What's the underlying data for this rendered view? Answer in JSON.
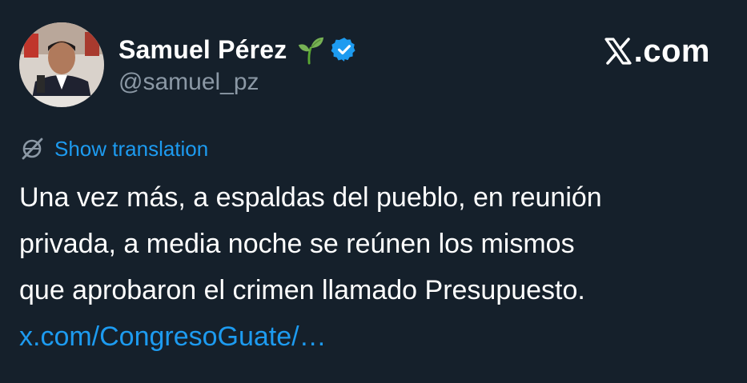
{
  "author": {
    "display_name": "Samuel Pérez",
    "handle": "@samuel_pz",
    "badge_emoji_icon": "sprout-icon",
    "verified_icon": "verified-badge-icon"
  },
  "brand": {
    "logo_icon": "x-logo-icon",
    "text": ".com"
  },
  "translation": {
    "icon": "globe-slash-icon",
    "label": "Show translation"
  },
  "tweet": {
    "lines": [
      "Una vez más, a espaldas del pueblo, en reunión",
      "privada, a media noche se reúnen los mismos",
      "que aprobaron el crimen llamado Presupuesto."
    ],
    "link": "x.com/CongresoGuate/…"
  },
  "colors": {
    "background": "#15202b",
    "text": "#ffffff",
    "muted": "#8b98a5",
    "link": "#1d9bf0",
    "verified": "#1d9bf0"
  }
}
